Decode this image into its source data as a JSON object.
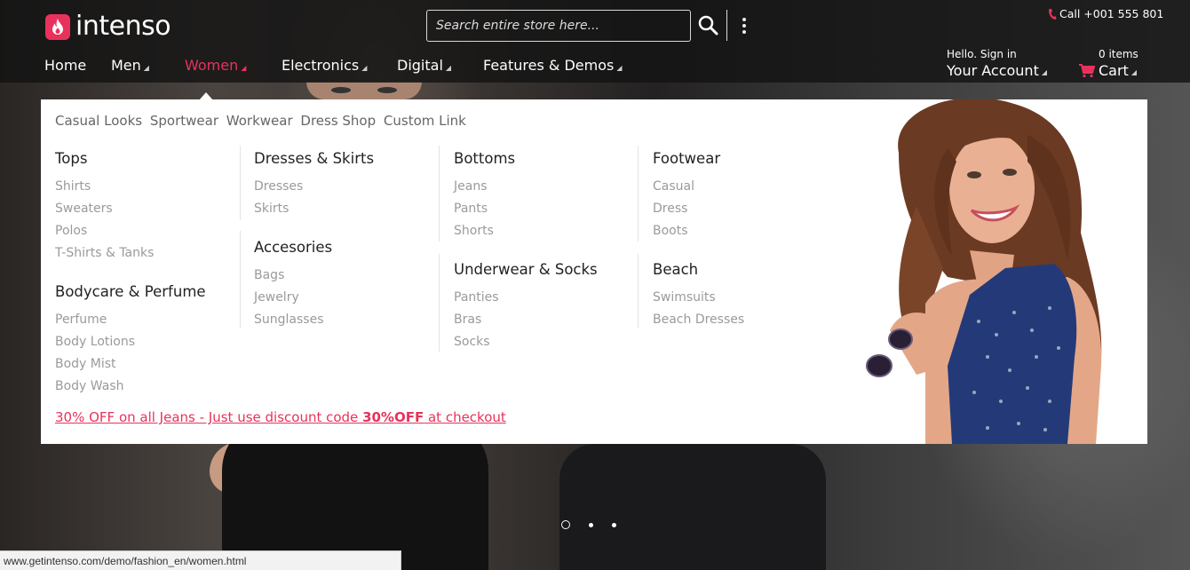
{
  "brand": {
    "name": "intenso",
    "accent": "#e8325b"
  },
  "search": {
    "placeholder": "Search entire store here..."
  },
  "contact": {
    "call": "Call +001 555 801"
  },
  "nav": [
    {
      "label": "Home"
    },
    {
      "label": "Men"
    },
    {
      "label": "Women"
    },
    {
      "label": "Electronics"
    },
    {
      "label": "Digital"
    },
    {
      "label": "Features & Demos"
    }
  ],
  "account": {
    "greeting": "Hello. Sign in",
    "label": "Your Account"
  },
  "cart": {
    "count": "0 items",
    "label": "Cart"
  },
  "mega_menu": {
    "quick_links": [
      "Casual Looks",
      "Sportwear",
      "Workwear",
      "Dress Shop",
      "Custom Link"
    ],
    "columns": [
      {
        "groups": [
          {
            "title": "Tops",
            "links": [
              "Shirts",
              "Sweaters",
              "Polos",
              "T-Shirts & Tanks"
            ]
          },
          {
            "title": "Bodycare & Perfume",
            "links": [
              "Perfume",
              "Body Lotions",
              "Body Mist",
              "Body Wash"
            ]
          }
        ]
      },
      {
        "groups": [
          {
            "title": "Dresses & Skirts",
            "links": [
              "Dresses",
              "Skirts"
            ]
          },
          {
            "title": "Accesories",
            "links": [
              "Bags",
              "Jewelry",
              "Sunglasses"
            ]
          }
        ]
      },
      {
        "groups": [
          {
            "title": "Bottoms",
            "links": [
              "Jeans",
              "Pants",
              "Shorts"
            ]
          },
          {
            "title": "Underwear & Socks",
            "links": [
              "Panties",
              "Bras",
              "Socks"
            ]
          }
        ]
      },
      {
        "groups": [
          {
            "title": "Footwear",
            "links": [
              "Casual",
              "Dress",
              "Boots"
            ]
          },
          {
            "title": "Beach",
            "links": [
              "Swimsuits",
              "Beach Dresses"
            ]
          }
        ]
      }
    ],
    "promo": {
      "prefix": "30% OFF on all Jeans - Just use discount code ",
      "code": "30%OFF",
      "suffix": " at checkout"
    }
  },
  "slider": {
    "dot_count": 3,
    "active_index": 0
  },
  "status_url": "www.getintenso.com/demo/fashion_en/women.html"
}
